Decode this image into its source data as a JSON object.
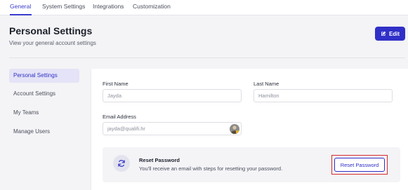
{
  "tabs": [
    {
      "label": "General",
      "active": true
    },
    {
      "label": "System Settings",
      "active": false
    },
    {
      "label": "Integrations",
      "active": false
    },
    {
      "label": "Customization",
      "active": false
    }
  ],
  "header": {
    "title": "Personal Settings",
    "subtitle": "View your general account settings",
    "edit_label": "Edit",
    "edit_icon": "edit-icon"
  },
  "sidebar": {
    "items": [
      {
        "label": "Personal Settings",
        "active": true
      },
      {
        "label": "Account Settings",
        "active": false
      },
      {
        "label": "My Teams",
        "active": false
      },
      {
        "label": "Manage Users",
        "active": false
      }
    ]
  },
  "form": {
    "first_name": {
      "label": "First Name",
      "value": "Jayda"
    },
    "last_name": {
      "label": "Last Name",
      "value": "Hamilton"
    },
    "email": {
      "label": "Email Address",
      "value": "jayda@qualifi.hr"
    }
  },
  "reset_password": {
    "icon": "refresh-icon",
    "title": "Reset Password",
    "description": "You'll receive an email with steps for resetting your password.",
    "button_label": "Reset Password"
  },
  "colors": {
    "accent": "#3030c8",
    "highlight": "#d62b2b",
    "active_nav_bg": "#e4e3f7"
  }
}
